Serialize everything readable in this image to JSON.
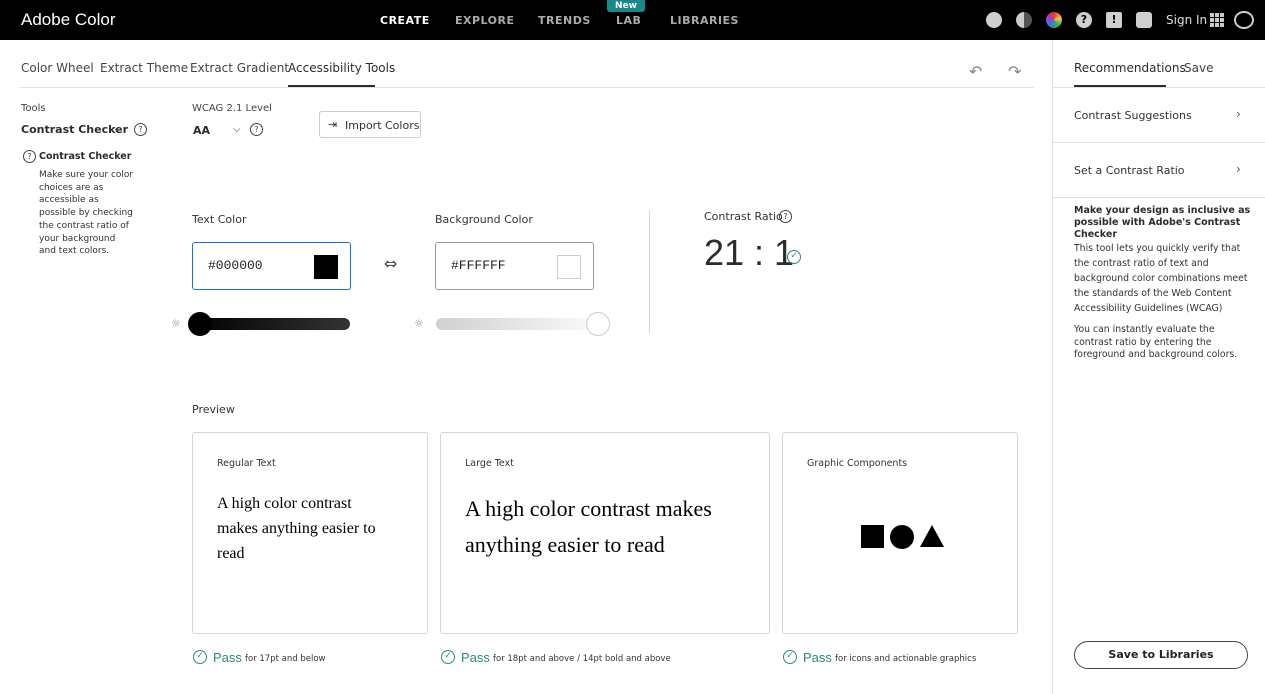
{
  "app": {
    "title": "Adobe Color"
  },
  "nav": {
    "create": "CREATE",
    "explore": "EXPLORE",
    "trends": "TRENDS",
    "lab": "LAB",
    "libraries": "LIBRARIES",
    "new_badge": "New",
    "signin": "Sign In"
  },
  "tabs": {
    "color_wheel": "Color Wheel",
    "extract_theme": "Extract Theme",
    "extract_gradient": "Extract Gradient",
    "accessibility": "Accessibility Tools"
  },
  "tools": {
    "label": "Tools",
    "selected": "Contrast Checker",
    "info_title": "Contrast Checker",
    "info_desc": "Make sure your color choices are as accessible as possible by checking the contrast ratio of your background and text colors."
  },
  "wcag": {
    "label": "WCAG 2.1 Level",
    "value": "AA"
  },
  "import_button": "Import Colors",
  "text_color": {
    "label": "Text Color",
    "value": "#000000",
    "swatch": "#000000",
    "brightness": 0
  },
  "bg_color": {
    "label": "Background Color",
    "value": "#FFFFFF",
    "swatch": "#FFFFFF",
    "brightness": 1
  },
  "contrast": {
    "label": "Contrast Ratio",
    "value": "21 : 1"
  },
  "preview": {
    "label": "Preview",
    "regular": {
      "title": "Regular Text",
      "text": "A high color contrast makes anything easier to read",
      "pass": "Pass",
      "note": "for 17pt and below"
    },
    "large": {
      "title": "Large Text",
      "text": "A high color contrast makes anything easier to read",
      "pass": "Pass",
      "note": "for 18pt and above / 14pt bold and above"
    },
    "graphic": {
      "title": "Graphic Components",
      "pass": "Pass",
      "note": "for icons and actionable graphics"
    }
  },
  "right_panel": {
    "tab_recommendations": "Recommendations",
    "tab_save": "Save",
    "suggestions": "Contrast Suggestions",
    "set_ratio": "Set a Contrast Ratio",
    "heading": "Make your design as inclusive as possible with Adobe's Contrast Checker",
    "p1": "This tool lets you quickly verify that the contrast ratio of text and background color combinations meet the standards of the Web Content Accessibility Guidelines (WCAG)",
    "p2": "You can instantly evaluate the contrast ratio by entering the foreground and background colors.",
    "save_button": "Save to Libraries"
  },
  "colors": {
    "accent_pass": "#268e6c",
    "focus_blue": "#1473e6",
    "new_badge": "#178b8c"
  }
}
